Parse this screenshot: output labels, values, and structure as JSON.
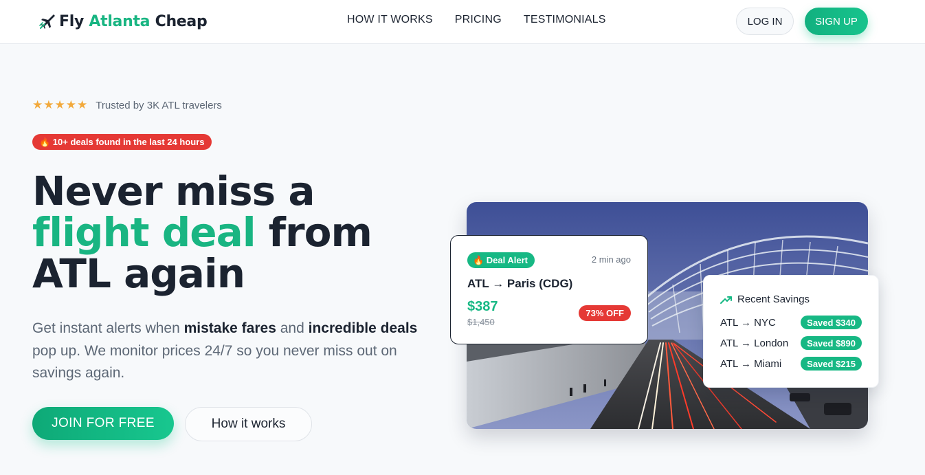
{
  "brand": {
    "name_part1": "Fly ",
    "name_part2": "Atlanta",
    "name_part3": " Cheap",
    "accent_color": "#19b582"
  },
  "nav": {
    "links": [
      "HOW IT WORKS",
      "PRICING",
      "TESTIMONIALS"
    ],
    "login_label": "LOG IN",
    "signup_label": "SIGN UP"
  },
  "hero": {
    "rating_stars": 5,
    "trust_text": "Trusted by 3K ATL travelers",
    "deals_badge": "🔥 10+ deals found in the last 24 hours",
    "headline_line1": "Never miss a",
    "headline_green": "flight deal",
    "headline_rest": " from",
    "headline_line3": "ATL again",
    "sub_part1": "Get instant alerts when ",
    "sub_bold1": "mistake fares",
    "sub_part2": " and ",
    "sub_bold2": "incredible deals",
    "sub_part3": " pop up. We monitor prices 24/7 so you never miss out on savings again.",
    "join_label": "JOIN FOR FREE",
    "how_label": "How it works"
  },
  "deal_card": {
    "pill": "🔥 Deal Alert",
    "time": "2 min ago",
    "route": "ATL → Paris (CDG)",
    "price": "$387",
    "old_price": "$1,450",
    "discount": "73% OFF"
  },
  "savings_card": {
    "title": "Recent Savings",
    "rows": [
      {
        "route": "ATL → NYC",
        "saved": "Saved $340"
      },
      {
        "route": "ATL → London",
        "saved": "Saved $890"
      },
      {
        "route": "ATL → Miami",
        "saved": "Saved $215"
      }
    ]
  },
  "icons": {
    "logo": "airplane-icon",
    "star": "star-icon",
    "trend": "trending-up-icon"
  },
  "colors": {
    "green": "#17b884",
    "red": "#e53935",
    "dark": "#1b2330",
    "star": "#f2a93b"
  }
}
